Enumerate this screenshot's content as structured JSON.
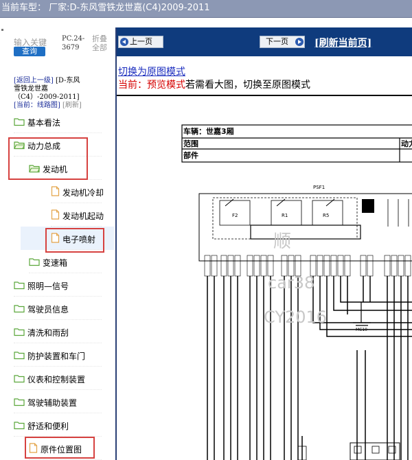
{
  "window": {
    "title": "当前车型：  厂家:D-东风雪铁龙世嘉(C4)2009-2011"
  },
  "search": {
    "keyword_label": "输入关键",
    "query_label": "查询",
    "pc_code_1": "PC.24-",
    "pc_code_2": "3679",
    "collapse_1": "折叠",
    "collapse_2": "全部"
  },
  "breadcrumb": {
    "back_label": "[返回上一级]",
    "vehicle_line1": "[D-东风",
    "vehicle_line2": "雪铁龙世嘉",
    "vehicle_line3": "（C4）-2009-2011]",
    "current_label": "[当前：线路图]",
    "refresh_label": "[刷新]"
  },
  "tree": {
    "items": [
      {
        "label": "基本看法",
        "type": "folder"
      },
      {
        "label": "动力总成",
        "type": "folder-open"
      },
      {
        "label": "发动机",
        "type": "folder-open"
      },
      {
        "label": "发动机冷却",
        "type": "file"
      },
      {
        "label": "发动机起动",
        "type": "file"
      },
      {
        "label": "电子喷射",
        "type": "file"
      },
      {
        "label": "变速箱",
        "type": "folder"
      },
      {
        "label": "照明—信号",
        "type": "folder"
      },
      {
        "label": "驾驶员信息",
        "type": "folder"
      },
      {
        "label": "清洗和雨刮",
        "type": "folder"
      },
      {
        "label": "防护装置和车门",
        "type": "folder"
      },
      {
        "label": "仪表和控制装置",
        "type": "folder"
      },
      {
        "label": "驾驶辅助装置",
        "type": "folder"
      },
      {
        "label": "舒适和便利",
        "type": "folder"
      },
      {
        "label": "原件位置图",
        "type": "file"
      }
    ]
  },
  "nav": {
    "prev_label": "上一页",
    "next_label": "下一页",
    "refresh_label": "[刷新当前页]"
  },
  "mode": {
    "switch_link": "切换为原图模式",
    "current_prefix": "当前：预览模式",
    "current_suffix": "若需看大图，切换至原图模式"
  },
  "diagram": {
    "vehicle_label": "车辆：世嘉3厢",
    "range_label": "范围",
    "range_value_partial": "动力",
    "part_label": "部件",
    "fuse_box_label": "PSF1",
    "relay_labels": [
      "F2",
      "R1",
      "R5"
    ],
    "module_label": "MC10",
    "watermark_1": "顺",
    "watermark_2": "car38",
    "watermark_3": "CY2016"
  },
  "colors": {
    "titlebar": "#8c98b4",
    "nav_bar": "#0f3b7d",
    "sidebar_border": "#2a3f75",
    "selection_red": "#d6413f",
    "accent_blue": "#1f6fc4"
  }
}
